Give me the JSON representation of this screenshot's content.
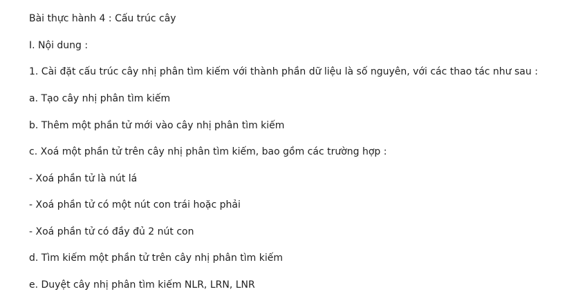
{
  "document": {
    "title": "Bài thực hành 4 : Cấu trúc cây",
    "section": "I. Nội dung :",
    "task": "1. Cài đặt cấu trúc cây nhị phân tìm kiếm với thành phần dữ liệu là số nguyên, với các thao tác như sau :",
    "items": [
      "a. Tạo cây nhị phân tìm kiếm",
      "b. Thêm một phần tử mới vào cây nhị phân tìm kiếm",
      "c. Xoá một phần tử trên cây nhị phân tìm kiếm, bao gồm các trường hợp :",
      "- Xoá phần tử là nút lá",
      "- Xoá phần tử có một nút con trái hoặc phải",
      "- Xoá phần tử có đầy đủ 2 nút con",
      "d. Tìm kiếm một phần tử trên cây nhị phân tìm kiếm",
      "e. Duyệt cây nhị phân tìm kiếm NLR, LRN, LNR"
    ]
  }
}
